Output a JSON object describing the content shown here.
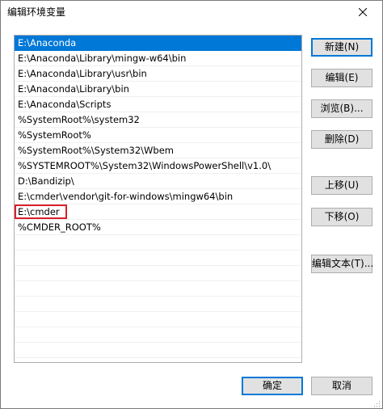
{
  "window": {
    "title": "编辑环境变量",
    "close_icon": "close-icon"
  },
  "path_list": {
    "selected_index": 0,
    "highlighted_index": 11,
    "items": [
      "E:\\Anaconda",
      "E:\\Anaconda\\Library\\mingw-w64\\bin",
      "E:\\Anaconda\\Library\\usr\\bin",
      "E:\\Anaconda\\Library\\bin",
      "E:\\Anaconda\\Scripts",
      "%SystemRoot%\\system32",
      "%SystemRoot%",
      "%SystemRoot%\\System32\\Wbem",
      "%SYSTEMROOT%\\System32\\WindowsPowerShell\\v1.0\\",
      "D:\\Bandizip\\",
      "E:\\cmder\\vendor\\git-for-windows\\mingw64\\bin",
      "E:\\cmder",
      "%CMDER_ROOT%",
      "",
      "",
      "",
      "",
      "",
      "",
      "",
      ""
    ]
  },
  "buttons": {
    "new": "新建(N)",
    "edit": "编辑(E)",
    "browse": "浏览(B)...",
    "delete": "删除(D)",
    "move_up": "上移(U)",
    "move_down": "下移(O)",
    "edit_text": "编辑文本(T)..."
  },
  "footer": {
    "ok": "确定",
    "cancel": "取消"
  },
  "colors": {
    "selection": "#0078d7",
    "highlight_box": "#d9202a",
    "button_face": "#e1e1e1"
  }
}
